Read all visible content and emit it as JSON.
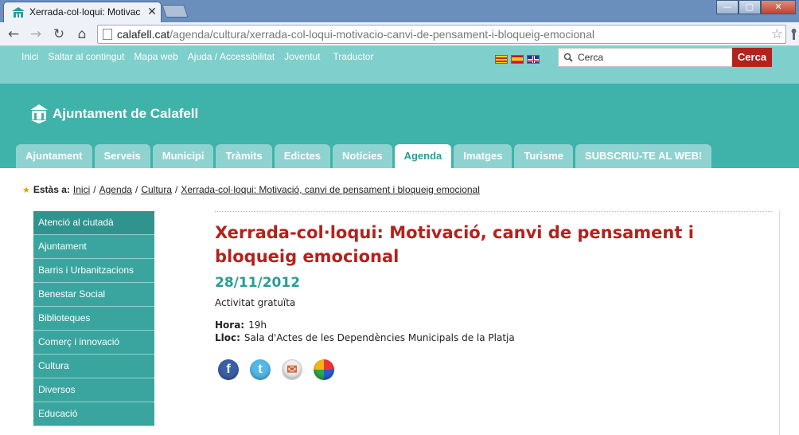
{
  "browser": {
    "tab_title": "Xerrada-col·loqui: Motivac",
    "url_domain": "calafell.cat",
    "url_path": "/agenda/cultura/xerrada-col-loqui-motivacio-canvi-de-pensament-i-bloqueig-emocional"
  },
  "toplinks": [
    "Inici",
    "Saltar al contingut",
    "Mapa web",
    "Ajuda / Accessibilitat",
    "Joventut",
    "Traductor"
  ],
  "languages": [
    "ca",
    "es",
    "en"
  ],
  "search": {
    "placeholder": "Cerca",
    "value": "Cerca",
    "button": "Cerca"
  },
  "site": {
    "name": "Ajuntament de Calafell"
  },
  "mainnav": [
    {
      "label": "Ajuntament",
      "active": false
    },
    {
      "label": "Serveis",
      "active": false
    },
    {
      "label": "Municipi",
      "active": false
    },
    {
      "label": "Tràmits",
      "active": false
    },
    {
      "label": "Edictes",
      "active": false
    },
    {
      "label": "Notícies",
      "active": false
    },
    {
      "label": "Agenda",
      "active": true
    },
    {
      "label": "Imatges",
      "active": false
    },
    {
      "label": "Turisme",
      "active": false
    },
    {
      "label": "SUBSCRIU-TE AL WEB!",
      "active": false
    }
  ],
  "breadcrumb": {
    "label": "Estàs a:",
    "items": [
      "Inici",
      "Agenda",
      "Cultura",
      "Xerrada-col·loqui: Motivació, canvi de pensament i bloqueig emocional"
    ]
  },
  "sidebar": [
    "Atenció al ciutadà",
    "Ajuntament",
    "Barris i Urbanitzacions",
    "Benestar Social",
    "Biblioteques",
    "Comerç i innovació",
    "Cultura",
    "Diversos",
    "Educació"
  ],
  "event": {
    "title": "Xerrada-col·loqui: Motivació, canvi de pensament i bloqueig emocional",
    "date": "28/11/2012",
    "price": "Activitat gratuïta",
    "time_label": "Hora:",
    "time": "19h",
    "place_label": "Lloc:",
    "place": "Sala d'Actes de les Dependències Municipals de la Platja"
  },
  "social": [
    "facebook-icon",
    "twitter-icon",
    "gmail-icon",
    "google-buzz-icon"
  ],
  "colors": {
    "teal": "#3fb2aa",
    "teal_light": "#7fcfcc",
    "red": "#b3221c",
    "date": "#2a9d96"
  }
}
